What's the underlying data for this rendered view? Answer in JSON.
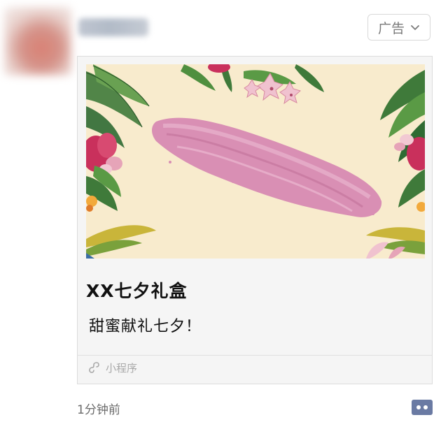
{
  "header": {
    "ad_label": "广告"
  },
  "card": {
    "title": "XX七夕礼盒",
    "subtitle": "甜蜜献礼七夕！",
    "footer_label": "小程序"
  },
  "post": {
    "time": "1分钟前"
  },
  "icons": {
    "ad_chevron": "chevron-down-icon",
    "mini_program": "mini-program-icon",
    "more": "more-comments-icon"
  },
  "colors": {
    "banner_bg": "#f8ebcd",
    "lipstick": "#d98fb4",
    "more_icon": "#6a7aa3"
  }
}
